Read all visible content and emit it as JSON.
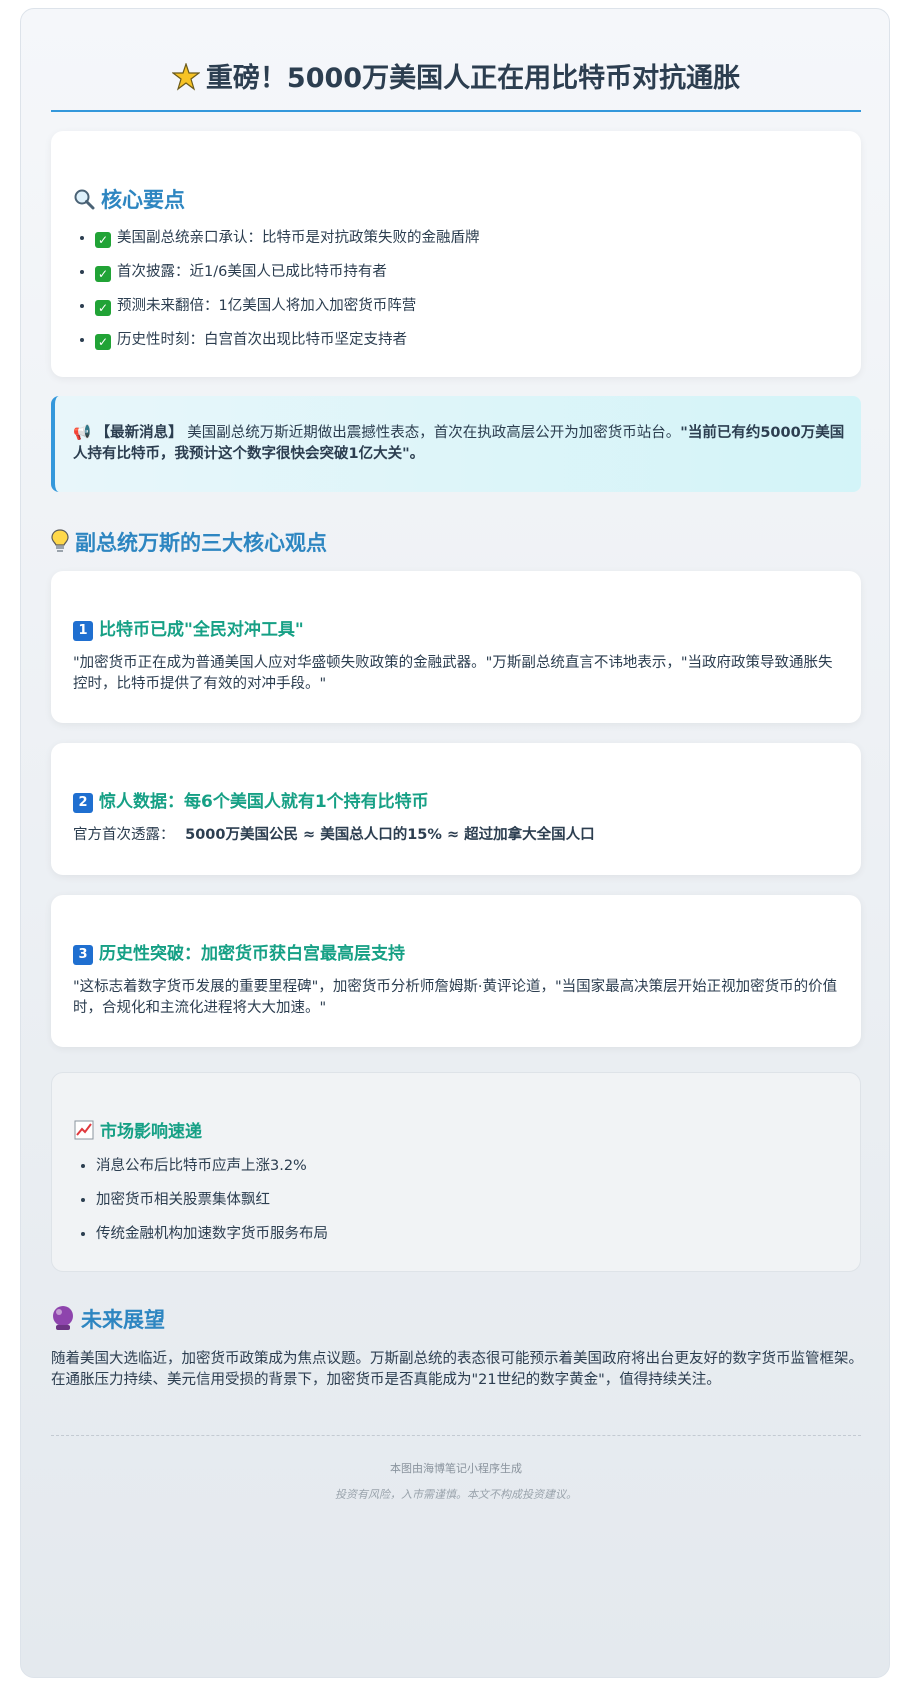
{
  "header": {
    "icon": "sparkle-star-icon",
    "title": "重磅！5000万美国人正在用比特币对抗通胀"
  },
  "key_points": {
    "icon": "magnifier-icon",
    "title": "核心要点",
    "items": [
      "美国副总统亲口承认：比特币是对抗政策失败的金融盾牌",
      "首次披露：近1/6美国人已成比特币持有者",
      "预测未来翻倍：1亿美国人将加入加密货币阵营",
      "历史性时刻：白宫首次出现比特币坚定支持者"
    ]
  },
  "news": {
    "icon": "megaphone-icon",
    "tag": "【最新消息】",
    "text": "美国副总统万斯近期做出震撼性表态，首次在执政高层公开为加密货币站台。",
    "quote": "\"当前已有约5000万美国人持有比特币，我预计这个数字很快会突破1亿大关\"。"
  },
  "views": {
    "icon": "lightbulb-icon",
    "title": "副总统万斯的三大核心观点",
    "items": [
      {
        "num": "1",
        "title": "比特币已成\"全民对冲工具\"",
        "text": "\"加密货币正在成为普通美国人应对华盛顿失败政策的金融武器。\"万斯副总统直言不讳地表示，\"当政府政策导致通胀失控时，比特币提供了有效的对冲手段。\""
      },
      {
        "num": "2",
        "title": "惊人数据：每6个美国人就有1个持有比特币",
        "text_prefix": "官方首次透露：",
        "text_bold": "5000万美国公民 ≈ 美国总人口的15% ≈ 超过加拿大全国人口"
      },
      {
        "num": "3",
        "title": "历史性突破：加密货币获白宫最高层支持",
        "text": "\"这标志着数字货币发展的重要里程碑\"，加密货币分析师詹姆斯·黄评论道，\"当国家最高决策层开始正视加密货币的价值时，合规化和主流化进程将大大加速。\""
      }
    ]
  },
  "market": {
    "icon": "chart-up-icon",
    "title": "市场影响速递",
    "items": [
      "消息公布后比特币应声上涨3.2%",
      "加密货币相关股票集体飘红",
      "传统金融机构加速数字货币服务布局"
    ]
  },
  "future": {
    "icon": "crystal-ball-icon",
    "title": "未来展望",
    "text": "随着美国大选临近，加密货币政策成为焦点议题。万斯副总统的表态很可能预示着美国政府将出台更友好的数字货币监管框架。在通胀压力持续、美元信用受损的背景下，加密货币是否真能成为\"21世纪的数字黄金\"，值得持续关注。"
  },
  "footer": {
    "generated": "本图由海博笔记小程序生成",
    "disclaimer": "投资有风险，入市需谨慎。本文不构成投资建议。"
  },
  "colors": {
    "accent_blue": "#2e86c1",
    "accent_teal": "#16a085",
    "rule_blue": "#3498db"
  }
}
